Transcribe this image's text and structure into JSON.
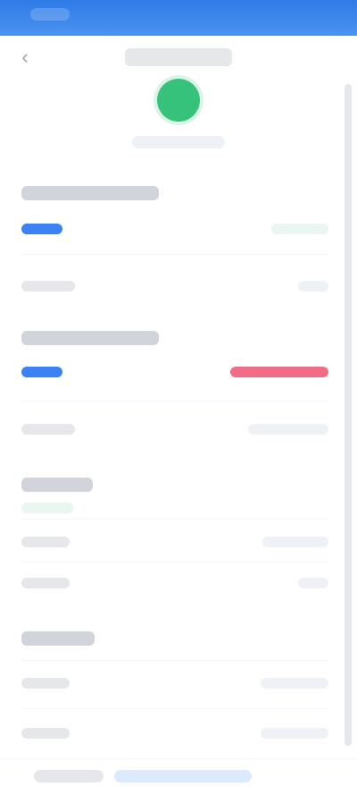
{
  "statusBar": {
    "time": ""
  },
  "header": {
    "title": "",
    "back_icon": "chevron-left-icon"
  },
  "profile": {
    "label": ""
  },
  "sections": [
    {
      "title": "",
      "sub": "",
      "pill": "",
      "pill_status": "",
      "rows": [
        {
          "label": "",
          "value": ""
        }
      ]
    },
    {
      "title": "",
      "sub": "",
      "pill": "",
      "pill_status": "",
      "rows": [
        {
          "label": "",
          "value": ""
        }
      ]
    },
    {
      "title": "",
      "sub": "",
      "rows": [
        {
          "label": "",
          "value": ""
        },
        {
          "label": "",
          "value": ""
        }
      ]
    },
    {
      "title": "",
      "rows": [
        {
          "label": "",
          "value": ""
        },
        {
          "label": "",
          "value": ""
        }
      ]
    }
  ],
  "bottomBar": {
    "left": "",
    "right": ""
  },
  "colors": {
    "primary": "#3b82f6",
    "success": "#38c684",
    "danger": "#f16d86",
    "header": "#2f7be8"
  }
}
